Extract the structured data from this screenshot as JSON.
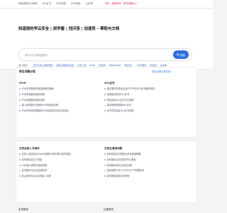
{
  "topbar": {
    "links": [
      "知道朋的学云教程",
      "SSL证书",
      "CDN知道",
      "DNS知道",
      "云存储"
    ],
    "promo": "APP，免费尽享，年年领取kcc"
  },
  "hero": {
    "title": "知道朋的学云安全 | 则学屋 | 找问答 | 加速员 – 帮助与文档",
    "search_placeholder": "有什么可以帮您的吗?",
    "search_button": "搜索"
  },
  "hot": {
    "label": "热门搜索：",
    "items": [
      "云安全接入需求教程",
      "获取云端重定加固",
      "日志下载",
      "https",
      "添加域",
      "Websocket",
      "重定接入",
      "IC&P服务",
      "网站测",
      "白名单"
    ]
  },
  "section1": {
    "title": "常见问题分类",
    "more": "常见问题分类全部 ›",
    "categories": [
      {
        "title": "IPV6",
        "items": [
          "IPv6支持配置与使用及解决指南",
          "IPv6安装服务使用说明",
          "IPv6改造服务使用说明",
          "接入和感配动中使用IPv6的使用说明",
          "IPv6可有效防御国际IPv6网站恶意攻击动态接入"
        ]
      },
      {
        "title": "SSL证书",
        "items": [
          "通过服务实现站点加HTTPS的SSL证书使用说明",
          "费用如何购买SSL证书",
          "网站启用SSL证书方法说明",
          "如何部署和配置SSL证书",
          "证书的安装及SSL证书说明"
        ]
      }
    ]
  },
  "section2": {
    "categories": [
      {
        "title": "云安全接入与测试",
        "items": [
          "在网上添加域名CNAME解析记录步骤与操作指南",
          "如何添加自定义规则",
          "CDN接入教程与使用说明",
          "会员服务与站点加速说明",
          "站点如何在后台实现接入设置"
        ]
      },
      {
        "title": "云安全通用问题",
        "items": [
          "如何在网站中配置云安全配置策略",
          "如何使用云安全防护SSL服务",
          "如何解决网站云安全问题",
          "如何部署CDN 41与POST不需要转发",
          "如何配置源站访问规则"
        ]
      }
    ]
  },
  "section3": {
    "left_label": "会员服务",
    "right_label": "加速服务"
  }
}
